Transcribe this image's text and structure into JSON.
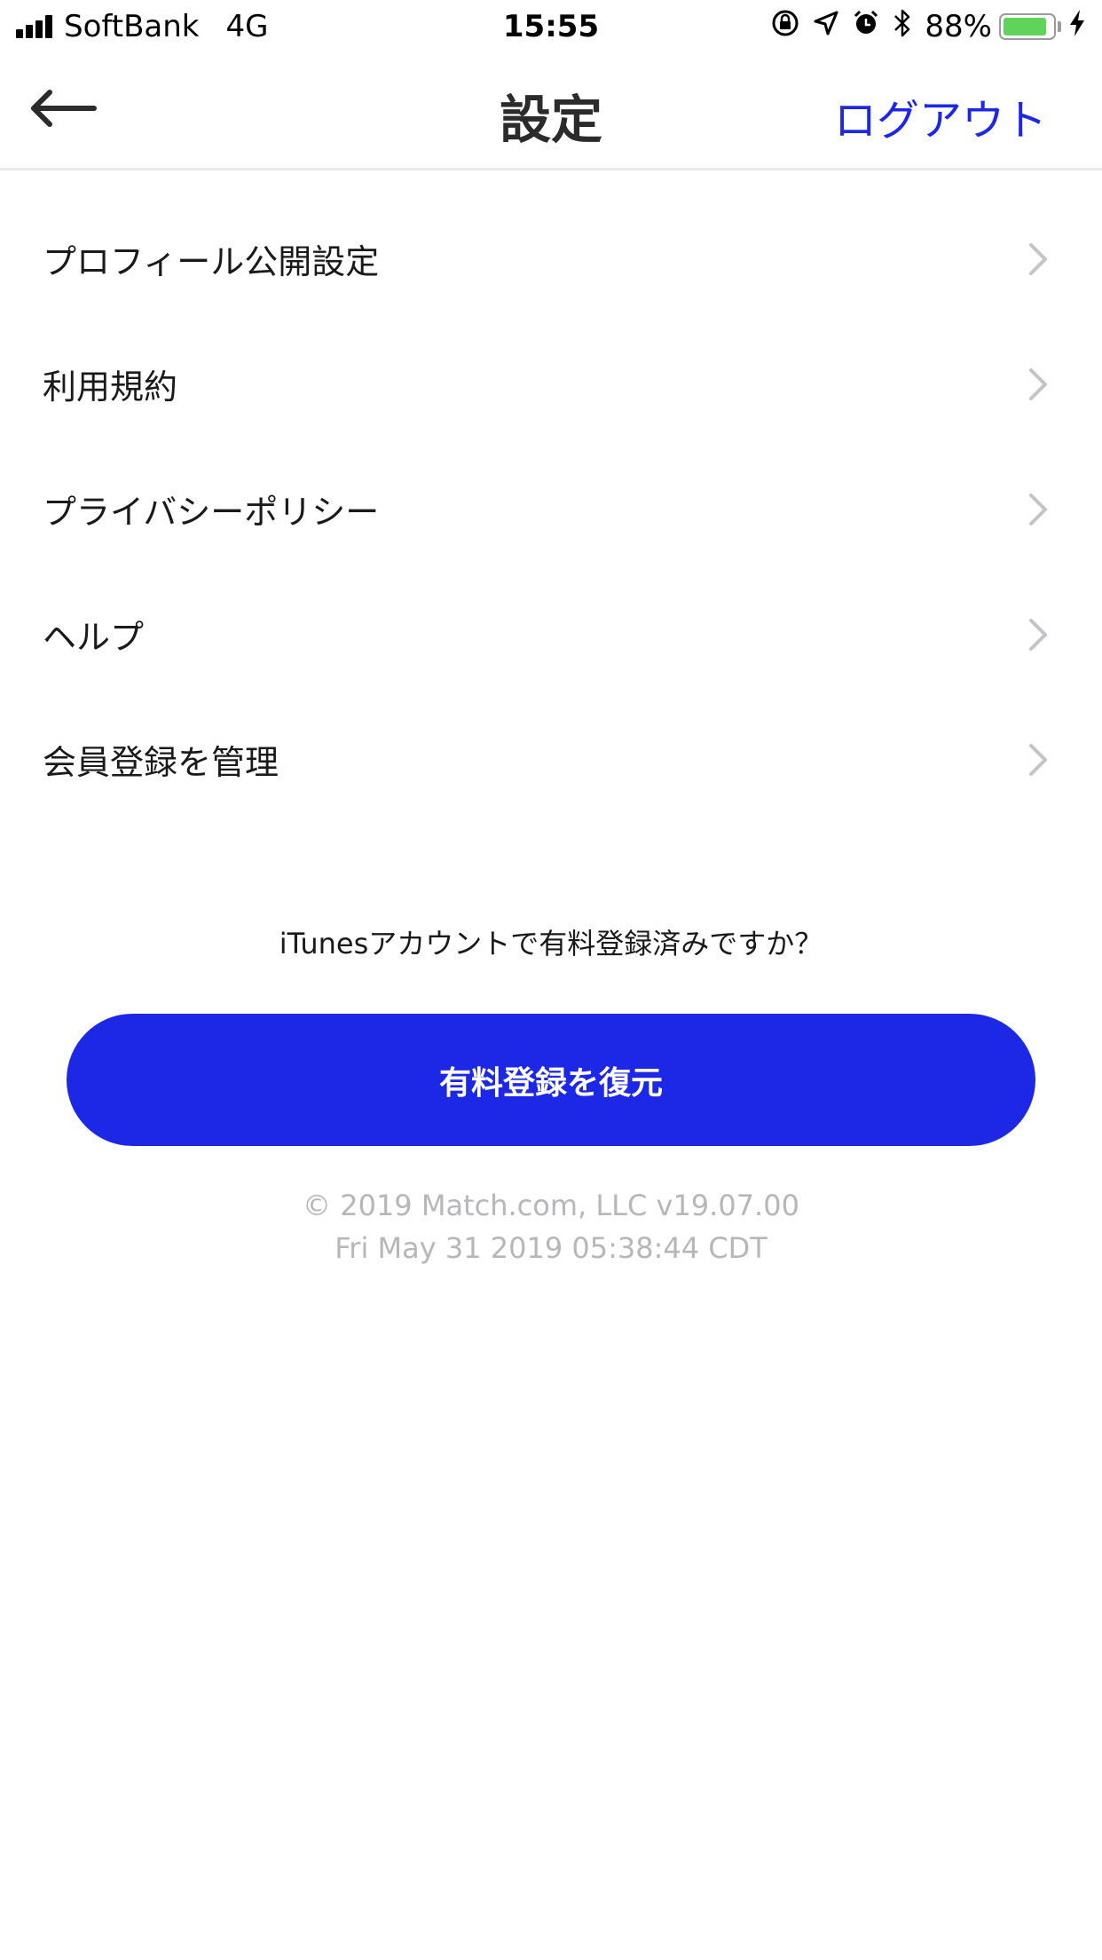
{
  "status_bar": {
    "carrier": "SoftBank",
    "network": "4G",
    "time": "15:55",
    "battery_percent": "88%",
    "battery_level": 0.88,
    "icons": [
      "orientation-lock-icon",
      "location-arrow-icon",
      "alarm-icon",
      "bluetooth-icon",
      "charging-bolt-icon"
    ]
  },
  "nav": {
    "title": "設定",
    "logout_label": "ログアウト",
    "back_icon": "back-arrow-icon",
    "accent_color": "#1d27e6"
  },
  "menu": {
    "items": [
      {
        "label": "プロフィール公開設定"
      },
      {
        "label": "利用規約"
      },
      {
        "label": "プライバシーポリシー"
      },
      {
        "label": "ヘルプ"
      },
      {
        "label": "会員登録を管理"
      }
    ],
    "chevron_icon": "chevron-right-icon"
  },
  "restore": {
    "question": "iTunesアカウントで有料登録済みですか？",
    "button_label": "有料登録を復元",
    "button_color": "#1d27e6"
  },
  "footer": {
    "copyright": "© 2019 Match.com, LLC v19.07.00",
    "build_date": "Fri May 31 2019 05:38:44 CDT"
  }
}
